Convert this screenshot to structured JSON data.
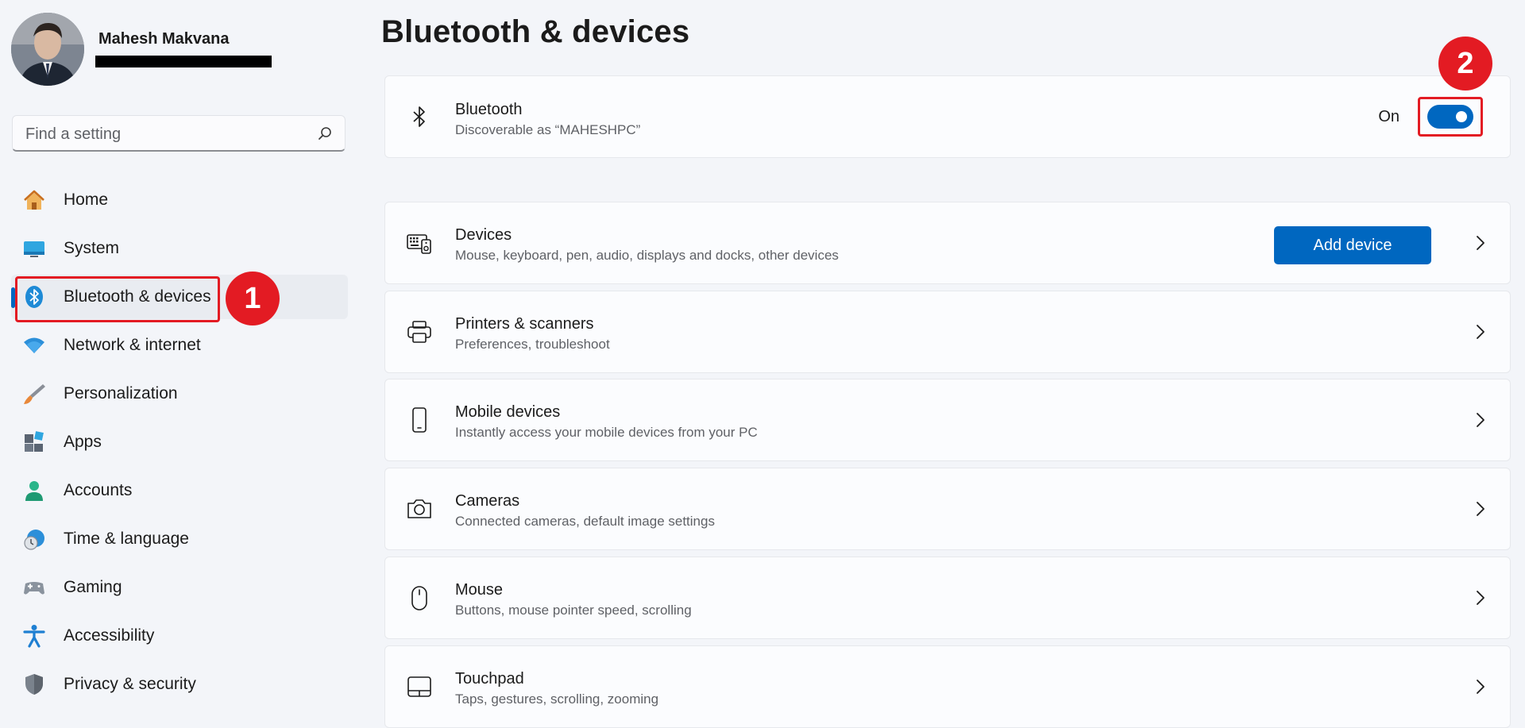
{
  "user": {
    "name": "Mahesh Makvana"
  },
  "search": {
    "placeholder": "Find a setting"
  },
  "sidebar": {
    "items": [
      {
        "label": "Home",
        "icon": "home-icon"
      },
      {
        "label": "System",
        "icon": "monitor-icon"
      },
      {
        "label": "Bluetooth & devices",
        "icon": "bluetooth-icon",
        "selected": true
      },
      {
        "label": "Network & internet",
        "icon": "wifi-icon"
      },
      {
        "label": "Personalization",
        "icon": "brush-icon"
      },
      {
        "label": "Apps",
        "icon": "apps-icon"
      },
      {
        "label": "Accounts",
        "icon": "person-icon"
      },
      {
        "label": "Time & language",
        "icon": "clock-globe-icon"
      },
      {
        "label": "Gaming",
        "icon": "gamepad-icon"
      },
      {
        "label": "Accessibility",
        "icon": "accessibility-icon"
      },
      {
        "label": "Privacy & security",
        "icon": "shield-icon"
      }
    ]
  },
  "callouts": {
    "first": "1",
    "second": "2"
  },
  "main": {
    "title": "Bluetooth & devices",
    "bluetooth": {
      "title": "Bluetooth",
      "subtitle": "Discoverable as “MAHESHPC”",
      "toggle_label": "On",
      "toggle_on": true
    },
    "devices": {
      "title": "Devices",
      "subtitle": "Mouse, keyboard, pen, audio, displays and docks, other devices",
      "button": "Add device"
    },
    "rows": [
      {
        "title": "Printers & scanners",
        "subtitle": "Preferences, troubleshoot",
        "icon": "printer-icon"
      },
      {
        "title": "Mobile devices",
        "subtitle": "Instantly access your mobile devices from your PC",
        "icon": "phone-icon"
      },
      {
        "title": "Cameras",
        "subtitle": "Connected cameras, default image settings",
        "icon": "camera-icon"
      },
      {
        "title": "Mouse",
        "subtitle": "Buttons, mouse pointer speed, scrolling",
        "icon": "mouse-icon"
      },
      {
        "title": "Touchpad",
        "subtitle": "Taps, gestures, scrolling, zooming",
        "icon": "touchpad-icon"
      }
    ]
  },
  "colors": {
    "accent": "#0067c0",
    "callout": "#e31b23"
  }
}
